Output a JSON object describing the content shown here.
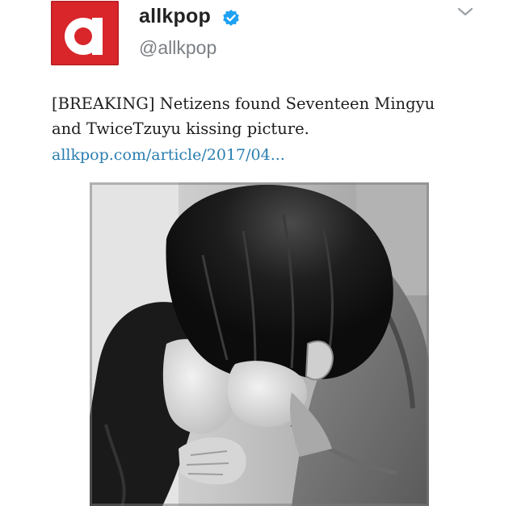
{
  "account": {
    "display_name": "allkpop",
    "handle": "@allkpop",
    "verified_icon": "verified-badge-icon",
    "avatar_icon": "allkpop-logo-icon",
    "brand_color": "#d8262a",
    "verified_color": "#1da1f2"
  },
  "menu": {
    "icon": "chevron-down-icon"
  },
  "tweet": {
    "text_line_1": "[BREAKING] Netizens found Seventeen Mingyu",
    "text_line_2": "and TwiceTzuyu kissing picture.",
    "link_text": "allkpop.com/article/2017/04...",
    "link_color": "#2a7db0"
  },
  "media": {
    "kind": "black-and-white photo"
  }
}
